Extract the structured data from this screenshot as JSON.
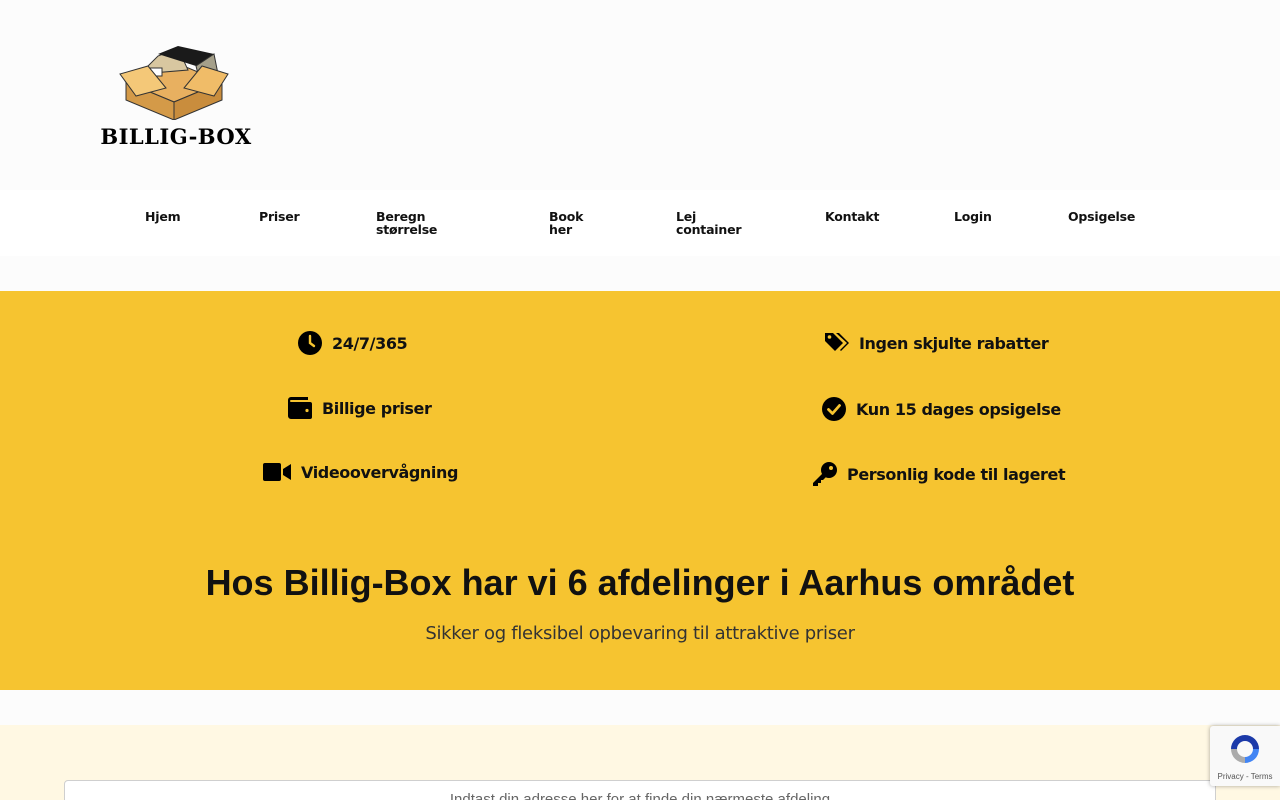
{
  "brand": {
    "name": "BILLIG-BOX"
  },
  "nav": {
    "items": [
      {
        "label": "Hjem"
      },
      {
        "label": "Priser"
      },
      {
        "label": "Beregn\nstørrelse"
      },
      {
        "label": "Book\nher"
      },
      {
        "label": "Lej\ncontainer"
      },
      {
        "label": "Kontakt"
      },
      {
        "label": "Login"
      },
      {
        "label": "Opsigelse"
      }
    ]
  },
  "features": [
    {
      "icon": "clock-icon",
      "label": "24/7/365"
    },
    {
      "icon": "tags-icon",
      "label": "Ingen skjulte rabatter"
    },
    {
      "icon": "wallet-icon",
      "label": "Billige priser"
    },
    {
      "icon": "check-circle-icon",
      "label": "Kun 15 dages opsigelse"
    },
    {
      "icon": "video-camera-icon",
      "label": "Videoovervågning"
    },
    {
      "icon": "key-icon",
      "label": "Personlig kode til lageret"
    }
  ],
  "hero": {
    "headline": "Hos Billig-Box har vi 6 afdelinger i Aarhus området",
    "subline": "Sikker og fleksibel opbevaring til attraktive priser"
  },
  "search": {
    "placeholder": "Indtast din adresse her for at finde din nærmeste afdeling"
  },
  "recaptcha": {
    "links": "Privacy - Terms"
  },
  "colors": {
    "band": "#f6c430",
    "lower_band": "#fff8e3",
    "header_bg": "#fcfcfc"
  }
}
